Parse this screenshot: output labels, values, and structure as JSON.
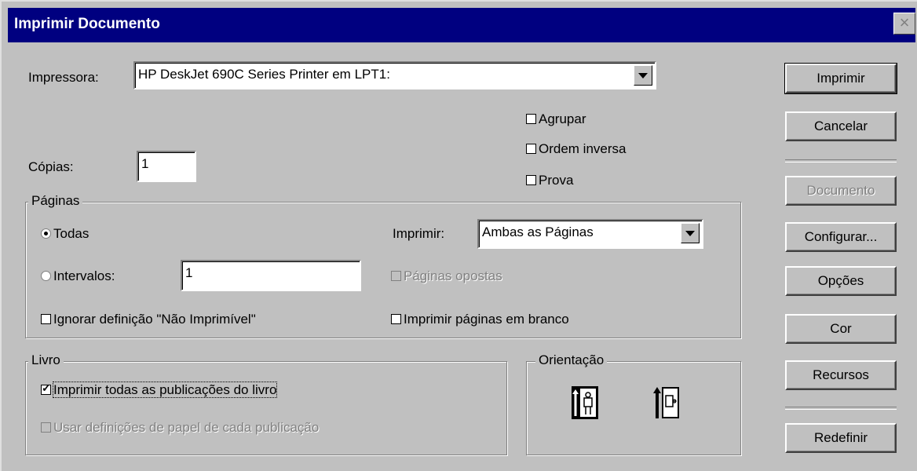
{
  "window": {
    "title": "Imprimir Documento"
  },
  "printer": {
    "label": "Impressora:",
    "value": "HP DeskJet 690C Series Printer em LPT1:"
  },
  "collate": {
    "agrupar": "Agrupar",
    "reverse": "Ordem inversa",
    "proof": "Prova"
  },
  "copies": {
    "label": "Cópias:",
    "value": "1"
  },
  "pages": {
    "legend": "Páginas",
    "all": "Todas",
    "ranges": "Intervalos:",
    "ranges_value": "1",
    "print_label": "Imprimir:",
    "print_value": "Ambas as Páginas",
    "facing": "Páginas opostas",
    "ignore_np": "Ignorar definição \"Não Imprimível\"",
    "blank": "Imprimir páginas em branco"
  },
  "book": {
    "legend": "Livro",
    "print_all": "Imprimir todas as publicações do livro",
    "use_paper": "Usar definições de papel de cada publicação"
  },
  "orientation": {
    "legend": "Orientação"
  },
  "buttons": {
    "print": "Imprimir",
    "cancel": "Cancelar",
    "document": "Documento",
    "setup": "Configurar...",
    "options": "Opções",
    "color": "Cor",
    "features": "Recursos",
    "reset": "Redefinir"
  },
  "icons": {
    "close": "close-icon",
    "portrait": "portrait-icon",
    "landscape": "landscape-icon",
    "dropdown": "chevron-down-icon"
  }
}
